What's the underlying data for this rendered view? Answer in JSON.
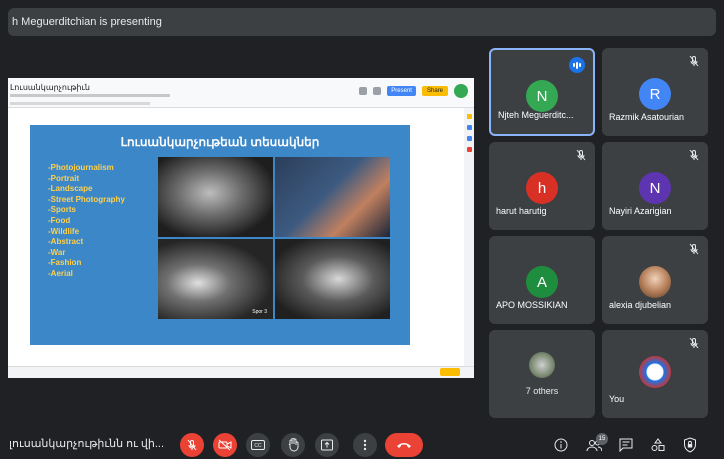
{
  "header": {
    "presenting_text": "h Meguerditchian is presenting"
  },
  "shared_doc": {
    "doc_title": "Լուսանկարչութիւն",
    "present_label": "Present",
    "slideshow_label": "Share"
  },
  "slide": {
    "heading": "Լուսանկարչութեան տեսակներ",
    "topics": [
      "-Photojournalism",
      "-Portrait",
      "-Landscape",
      "-Street Photography",
      "-Sports",
      "-Food",
      "-Wildlife",
      "-Abstract",
      "-War",
      "-Fashion",
      "-Aerial"
    ],
    "photo_credits": [
      "",
      "",
      "Spor 3",
      ""
    ]
  },
  "participants": [
    {
      "name": "Njteh Meguerditc...",
      "initial": "N",
      "color": "#34a853",
      "state": "speaking"
    },
    {
      "name": "Razmik Asatourian",
      "initial": "R",
      "color": "#4285f4",
      "state": "muted"
    },
    {
      "name": "harut harutig",
      "initial": "h",
      "color": "#d93025",
      "state": "muted"
    },
    {
      "name": "Nayiri Azarigian",
      "initial": "N",
      "color": "#5e35b1",
      "state": "muted"
    },
    {
      "name": "APO MOSSIKIAN",
      "initial": "A",
      "color": "#1e8e3e",
      "state": "normal"
    },
    {
      "name": "alexia djubelian",
      "initial": "",
      "color": "#c9a58a",
      "state": "muted"
    }
  ],
  "others_tile": {
    "label": "7 others"
  },
  "self_tile": {
    "label": "You"
  },
  "bottom_bar": {
    "meeting_name": "լուսանկարչութիւնն ու վի...",
    "people_count": "15"
  },
  "colors": {
    "accent": "#8ab4f8",
    "danger": "#ea4335",
    "tile_bg": "#3c4043",
    "page_bg": "#202124"
  }
}
